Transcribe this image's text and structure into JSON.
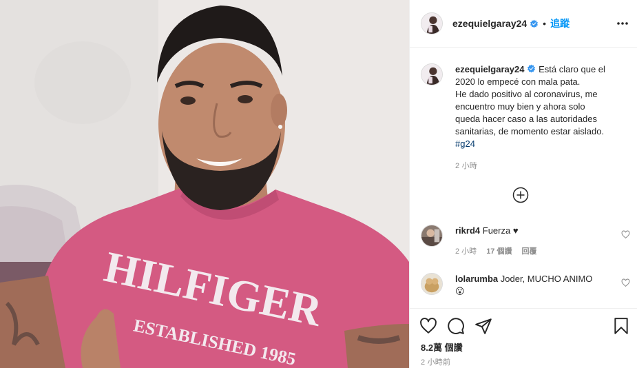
{
  "post": {
    "username": "ezequielgaray24",
    "verified": true,
    "follow_label": "追蹤",
    "dot": "•",
    "more_icon": "more-options-icon"
  },
  "caption": {
    "username": "ezequielgaray24",
    "lines": [
      "Está claro que el",
      "2020 lo empecé con mala pata.",
      "He dado positivo al coronavirus, me",
      "encuentro muy bien y ahora solo",
      "queda hacer caso a las autoridades",
      "sanitarias, de momento estar aislado."
    ],
    "hashtag": "#g24",
    "time": "2 小時"
  },
  "comments": [
    {
      "username": "rikrd4",
      "text": "Fuerza ♥",
      "time": "2 小時",
      "likes": "17 個讚",
      "reply": "回覆"
    },
    {
      "username": "lolarumba",
      "text": "Joder, MUCHO ANIMO",
      "emoji": "😮"
    }
  ],
  "footer": {
    "likes": "8.2萬 個讚",
    "time": "2 小時前"
  },
  "photo": {
    "shirt_text": "HILFIGER",
    "shirt_subtext": "ESTABLISHED 1985"
  },
  "colors": {
    "link_blue": "#0095f6",
    "hashtag": "#00376b",
    "muted": "#8e8e8e",
    "text": "#262626",
    "shirt_pink": "#d45a82"
  }
}
